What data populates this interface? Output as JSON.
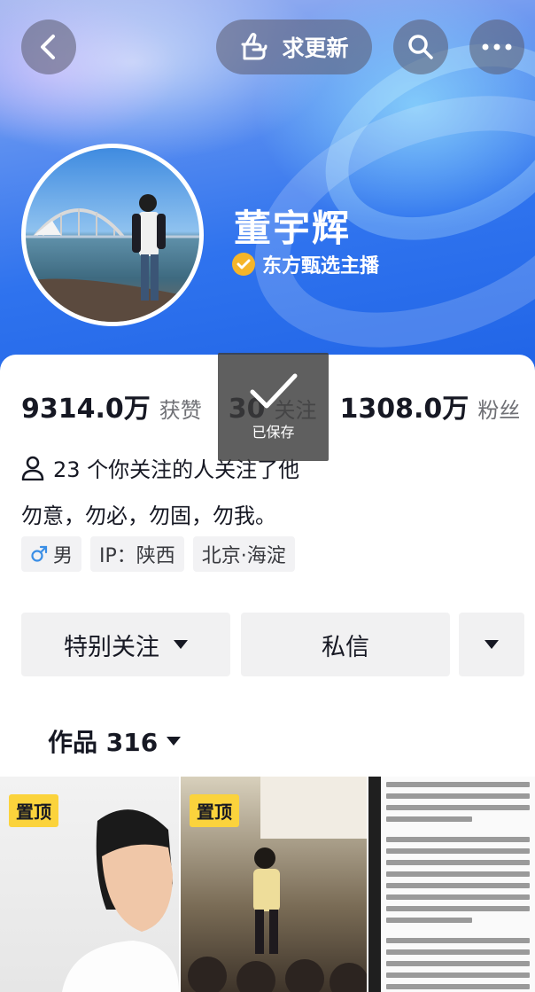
{
  "header": {
    "update_label": "求更新",
    "name": "董宇辉",
    "verify_label": "东方甄选主播"
  },
  "stats": {
    "likes_value": "9314.0万",
    "likes_label": "获赞",
    "following_value": "30",
    "following_label": "关注",
    "followers_value": "1308.0万",
    "followers_label": "粉丝"
  },
  "profile": {
    "mutual_text": "23 个你关注的人关注了他",
    "bio": "勿意，勿必，勿固，勿我。",
    "tags": [
      "男",
      "IP：陕西",
      "北京·海淀"
    ]
  },
  "actions": {
    "follow_label": "特别关注",
    "message_label": "私信"
  },
  "works": {
    "tab_label": "作品 316",
    "pinned_label": "置顶"
  },
  "toast": {
    "text": "已保存"
  },
  "colors": {
    "accent_banner": "#2f73ee",
    "verify_badge": "#f5b52a",
    "pin_badge": "#fbd33c"
  }
}
